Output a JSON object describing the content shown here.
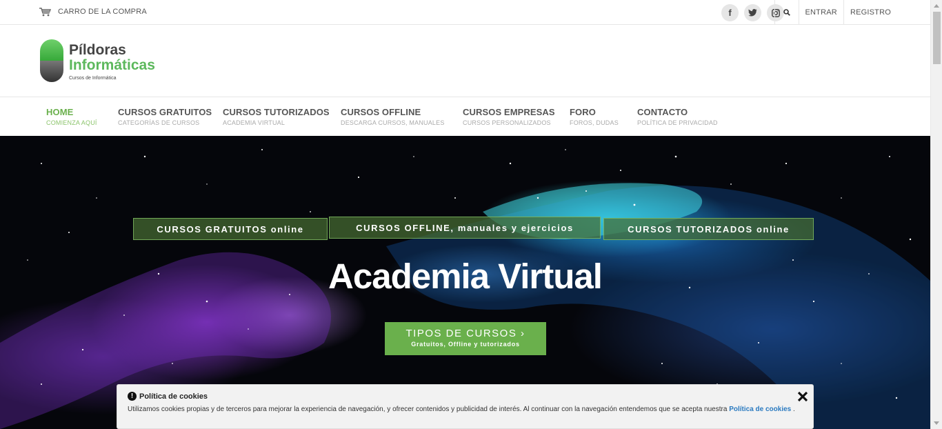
{
  "topbar": {
    "cart_label": "CARRO DE LA COMPRA",
    "social": [
      {
        "icon": "facebook-icon",
        "glyph": "f"
      },
      {
        "icon": "twitter-icon",
        "glyph": "t"
      },
      {
        "icon": "instagram-icon",
        "glyph": "◘"
      }
    ],
    "login_label": "ENTRAR",
    "register_label": "REGISTRO"
  },
  "logo": {
    "line1": "Píldoras",
    "line2": "Informáticas",
    "tagline": "Cursos de Informática"
  },
  "nav": {
    "items": [
      {
        "label": "HOME",
        "sub": "COMIENZA AQUÍ",
        "active": true
      },
      {
        "label": "CURSOS GRATUITOS",
        "sub": "CATEGORÍAS DE CURSOS"
      },
      {
        "label": "CURSOS TUTORIZADOS",
        "sub": "ACADEMIA VIRTUAL"
      },
      {
        "label": "CURSOS OFFLINE",
        "sub": "DESCARGA CURSOS, MANUALES"
      },
      {
        "label": "CURSOS EMPRESAS",
        "sub": "CURSOS PERSONALIZADOS"
      },
      {
        "label": "FORO",
        "sub": "FOROS, DUDAS"
      },
      {
        "label": "CONTACTO",
        "sub": "POLÍTICA DE PRIVACIDAD"
      }
    ]
  },
  "hero": {
    "buttons": [
      "CURSOS GRATUITOS online",
      "CURSOS OFFLINE, manuales y ejercicios",
      "CURSOS TUTORIZADOS online"
    ],
    "title": "Academia Virtual",
    "cta_label": "TIPOS DE CURSOS ›",
    "cta_sub": "Gratuitos, Offline y tutorizados"
  },
  "cookie": {
    "title": "Política de cookies",
    "text": "Utilizamos cookies propias y de terceros para mejorar la experiencia de navegación, y ofrecer contenidos y publicidad de interés. Al continuar con la navegación entendemos que se acepta nuestra Política de cookies.",
    "link": "Política de cookies",
    "end": " ."
  },
  "colors": {
    "accent": "#6ab04c",
    "logo_green": "#5cb85c",
    "link_blue": "#2a7ac0"
  }
}
